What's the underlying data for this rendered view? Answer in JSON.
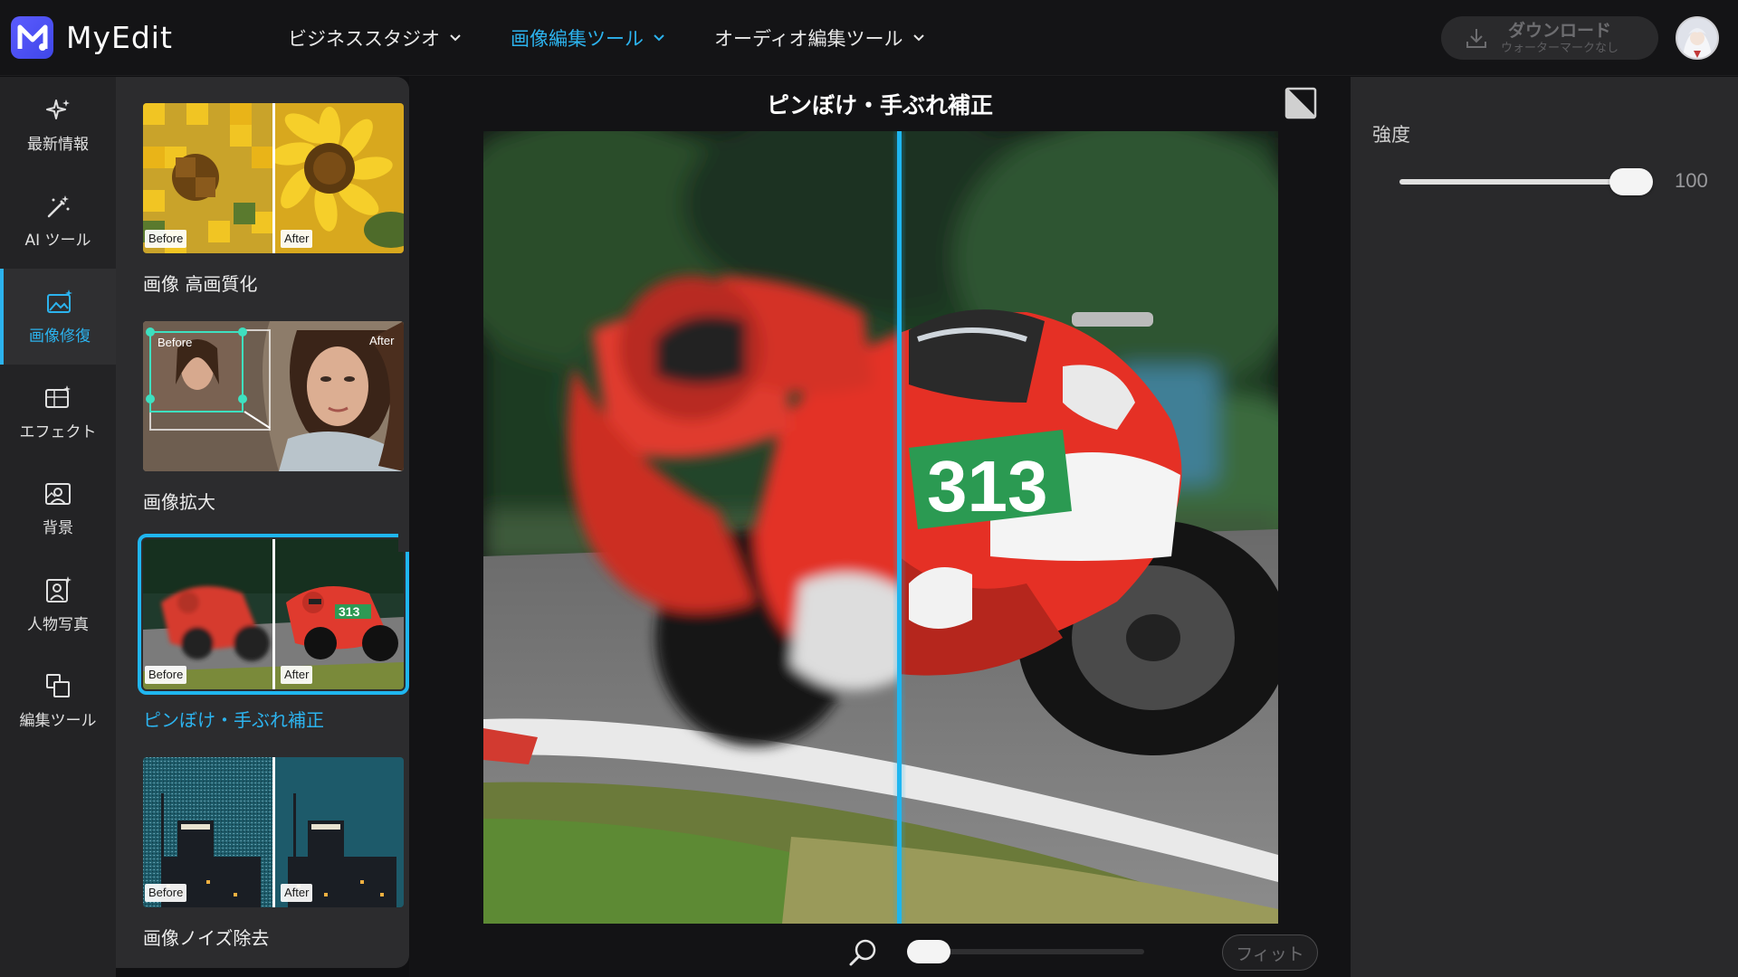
{
  "app": {
    "name": "MyEdit",
    "logo_letter": "M"
  },
  "nav": [
    {
      "label": "ビジネススタジオ",
      "active": false
    },
    {
      "label": "画像編集ツール",
      "active": true
    },
    {
      "label": "オーディオ編集ツール",
      "active": false
    }
  ],
  "download": {
    "label": "ダウンロード",
    "sublabel": "ウォーターマークなし"
  },
  "rail": [
    {
      "label": "最新情報",
      "icon": "sparkle-icon"
    },
    {
      "label": "AI ツール",
      "icon": "magic-wand-icon"
    },
    {
      "label": "画像修復",
      "icon": "image-repair-icon",
      "active": true
    },
    {
      "label": "エフェクト",
      "icon": "effect-icon"
    },
    {
      "label": "背景",
      "icon": "background-icon"
    },
    {
      "label": "人物写真",
      "icon": "portrait-icon"
    },
    {
      "label": "編集ツール",
      "icon": "edit-tools-icon"
    }
  ],
  "tools": [
    {
      "label": "画像 高画質化",
      "before": "Before",
      "after": "After"
    },
    {
      "label": "画像拡大",
      "before": "Before",
      "after": "After"
    },
    {
      "label": "ピンぼけ・手ぶれ補正",
      "before": "Before",
      "after": "After",
      "active": true
    },
    {
      "label": "画像ノイズ除去",
      "before": "Before",
      "after": "After"
    }
  ],
  "canvas": {
    "title": "ピンぼけ・手ぶれ補正",
    "rider_number": "313"
  },
  "zoom": {
    "fit_label": "フィット",
    "level": 0
  },
  "settings": {
    "strength_label": "強度",
    "strength_value": "100"
  },
  "colors": {
    "accent": "#2cb3ee",
    "active_border": "#1fb6f0"
  }
}
